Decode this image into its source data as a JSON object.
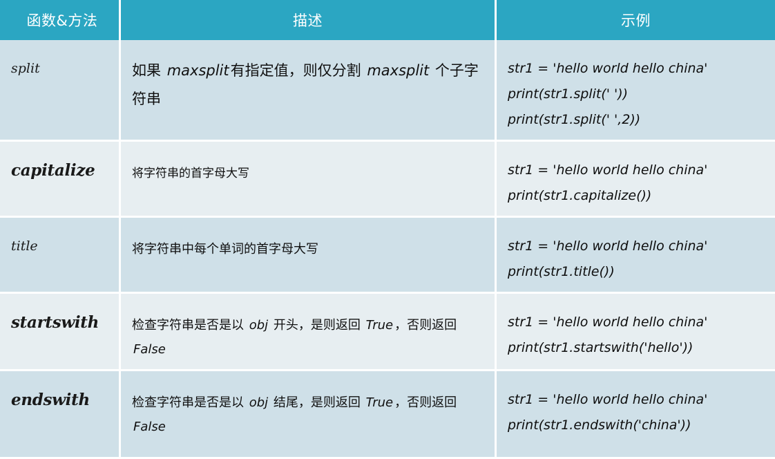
{
  "table": {
    "columns": [
      {
        "id": "function",
        "label": "函数&方法",
        "align": "center"
      },
      {
        "id": "description",
        "label": "描述",
        "align": "center"
      },
      {
        "id": "example",
        "label": "示例",
        "align": "center"
      }
    ],
    "header_bg": "#2ba6c2",
    "header_text_color": "#ffffff",
    "row_shade_dark": "#cfe0e8",
    "row_shade_light": "#e7eef1",
    "grid_color": "#ffffff",
    "rows": [
      {
        "function": "split",
        "function_style": "regular-italic",
        "description_parts": [
          {
            "text": "如果 ",
            "style": "cjk"
          },
          {
            "text": "maxsplit",
            "style": "italic"
          },
          {
            "text": "有指定值，则仅分割 ",
            "style": "cjk"
          },
          {
            "text": "maxsplit",
            "style": "italic"
          },
          {
            "text": " 个子字符串",
            "style": "cjk"
          }
        ],
        "description_plain": "如果 maxsplit有指定值，则仅分割 maxsplit 个子字符串",
        "example_lines": [
          "str1 = 'hello world hello china'",
          "print(str1.split(' '))",
          "print(str1.split(' ',2))"
        ],
        "shade": "dark"
      },
      {
        "function": "capitalize",
        "function_style": "bold-italic",
        "description_parts": [
          {
            "text": "将字符串的首字母大写",
            "style": "cjk"
          }
        ],
        "description_plain": "将字符串的首字母大写",
        "example_lines": [
          "str1 = 'hello world hello china'",
          "print(str1.capitalize())"
        ],
        "shade": "light"
      },
      {
        "function": "title",
        "function_style": "regular-italic",
        "description_parts": [
          {
            "text": "将字符串中每个单词的首字母大写",
            "style": "cjk"
          }
        ],
        "description_plain": "将字符串中每个单词的首字母大写",
        "example_lines": [
          "str1 = 'hello world hello china'",
          "print(str1.title())"
        ],
        "shade": "dark"
      },
      {
        "function": "startswith",
        "function_style": "bold-italic",
        "description_parts": [
          {
            "text": "检查字符串是否是以 ",
            "style": "cjk"
          },
          {
            "text": "obj",
            "style": "italic"
          },
          {
            "text": " 开头，是则返回 ",
            "style": "cjk"
          },
          {
            "text": "True",
            "style": "italic"
          },
          {
            "text": "，否则返回 ",
            "style": "cjk"
          },
          {
            "text": "False",
            "style": "italic"
          }
        ],
        "description_plain": "检查字符串是否是以 obj 开头，是则返回 True，否则返回 False",
        "example_lines": [
          "str1 = 'hello world hello china'",
          "print(str1.startswith('hello'))"
        ],
        "shade": "light"
      },
      {
        "function": "endswith",
        "function_style": "bold-italic",
        "description_parts": [
          {
            "text": "检查字符串是否是以 ",
            "style": "cjk"
          },
          {
            "text": "obj",
            "style": "italic"
          },
          {
            "text": " 结尾，是则返回 ",
            "style": "cjk"
          },
          {
            "text": "True",
            "style": "italic"
          },
          {
            "text": "，否则返回 ",
            "style": "cjk"
          },
          {
            "text": "False",
            "style": "italic"
          }
        ],
        "description_plain": "检查字符串是否是以 obj 结尾，是则返回 True，否则返回 False",
        "example_lines": [
          "str1 = 'hello world hello china'",
          "print(str1.endswith('china'))"
        ],
        "shade": "dark"
      }
    ]
  }
}
